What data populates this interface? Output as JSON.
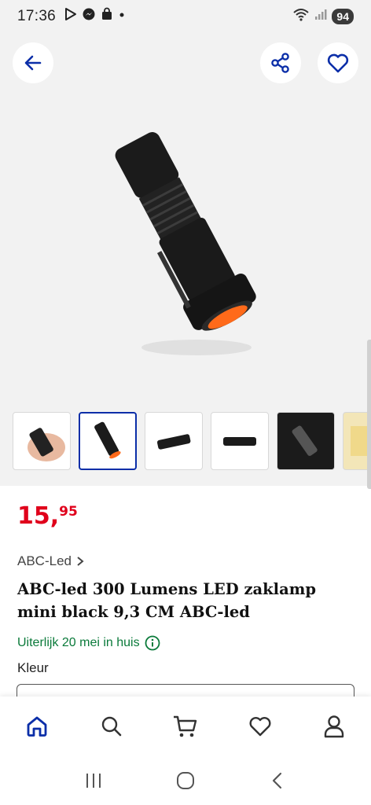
{
  "status_bar": {
    "time": "17:36",
    "battery": "94",
    "notification_icons": [
      "play-store-icon",
      "messenger-icon",
      "shopping-bag-icon",
      "dot-icon"
    ],
    "system_icons": [
      "wifi-icon",
      "signal-icon"
    ]
  },
  "gallery": {
    "back_icon": "arrow-left-icon",
    "share_icon": "share-icon",
    "favorite_icon": "heart-icon",
    "selected_index": 1,
    "thumbnail_count": 6
  },
  "product": {
    "price_main": "15,",
    "price_cents": "95",
    "brand": "ABC-Led",
    "title": "ABC-led 300 Lumens LED zaklamp mini black 9,3 CM ABC-led",
    "delivery": "Uiterlijk 20 mei in huis",
    "color_label": "Kleur"
  },
  "bottom_nav": {
    "items": [
      "home-icon",
      "search-icon",
      "cart-icon",
      "heart-icon",
      "account-icon"
    ],
    "active": "home-icon"
  },
  "system_nav": {
    "items": [
      "recents-icon",
      "home-circle-icon",
      "back-chevron-icon"
    ]
  },
  "colors": {
    "accent": "#0b2ea8",
    "price": "#e0001b",
    "delivery": "#0a7a3a",
    "background": "#f2f2f2"
  }
}
